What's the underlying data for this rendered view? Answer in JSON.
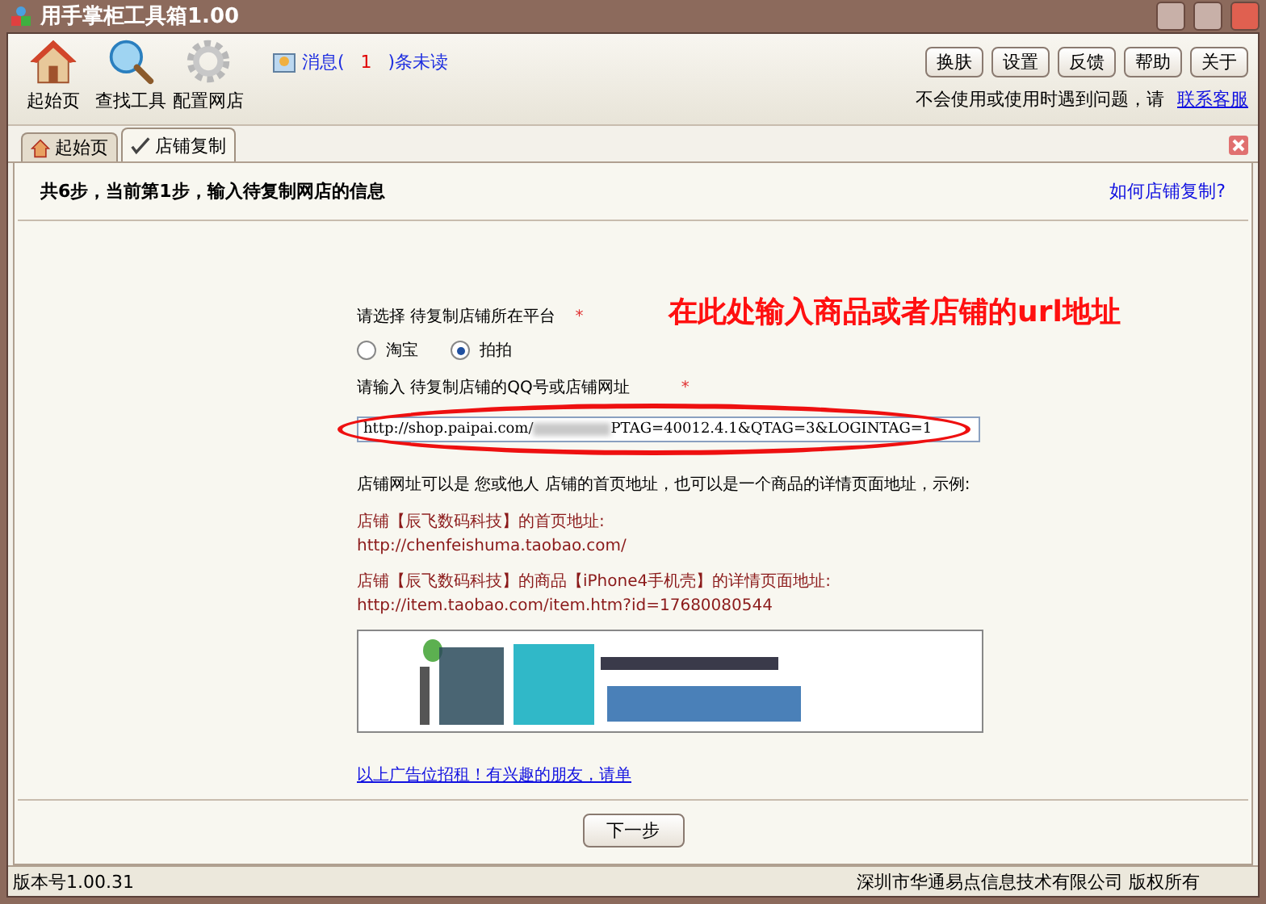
{
  "window": {
    "title": "用手掌柜工具箱1.00"
  },
  "toolbar": {
    "tools": [
      {
        "label": "起始页",
        "kind": "house"
      },
      {
        "label": "查找工具",
        "kind": "search"
      },
      {
        "label": "配置网店",
        "kind": "gear"
      }
    ],
    "message": {
      "prefix": "消息(",
      "count": "1",
      "suffix": ")条未读"
    },
    "buttons": [
      "换肤",
      "设置",
      "反馈",
      "帮助",
      "关于"
    ],
    "help_text": "不会使用或使用时遇到问题，请",
    "help_link": "联系客服"
  },
  "tabs": [
    {
      "label": "起始页",
      "kind": "house",
      "selected": false
    },
    {
      "label": "店铺复制",
      "kind": "check",
      "selected": true
    }
  ],
  "step_header": {
    "text": "共6步，当前第1步，输入待复制网店的信息",
    "link": "如何店铺复制?"
  },
  "form": {
    "platform_label": "请选择 待复制店铺所在平台",
    "platform_required": "*",
    "platforms": [
      {
        "label": "淘宝",
        "selected": false
      },
      {
        "label": "拍拍",
        "selected": true
      }
    ],
    "url_label": "请输入 待复制店铺的QQ号或店铺网址",
    "url_required": "*",
    "url_value_start": "http://shop.paipai.com/",
    "url_value_end": "PTAG=40012.4.1&QTAG=3&LOGINTAG=1"
  },
  "note": "店铺网址可以是 您或他人 店铺的首页地址，也可以是一个商品的详情页面地址，示例:",
  "examples": [
    {
      "label": "店铺【辰飞数码科技】的首页地址:",
      "url": "http://chenfeishuma.taobao.com/"
    },
    {
      "label": "店铺【辰飞数码科技】的商品【iPhone4手机壳】的详情页面地址:",
      "url": "http://item.taobao.com/item.htm?id=17680080544"
    }
  ],
  "ad_link": "以上广告位招租！有兴趣的朋友，请单",
  "annotation": {
    "text": "在此处输入商品或者店铺的url地址"
  },
  "next_button": "下一步",
  "status_bar": {
    "version": "版本号1.00.31",
    "copyright": "深圳市华通易点信息技术有限公司 版权所有"
  }
}
